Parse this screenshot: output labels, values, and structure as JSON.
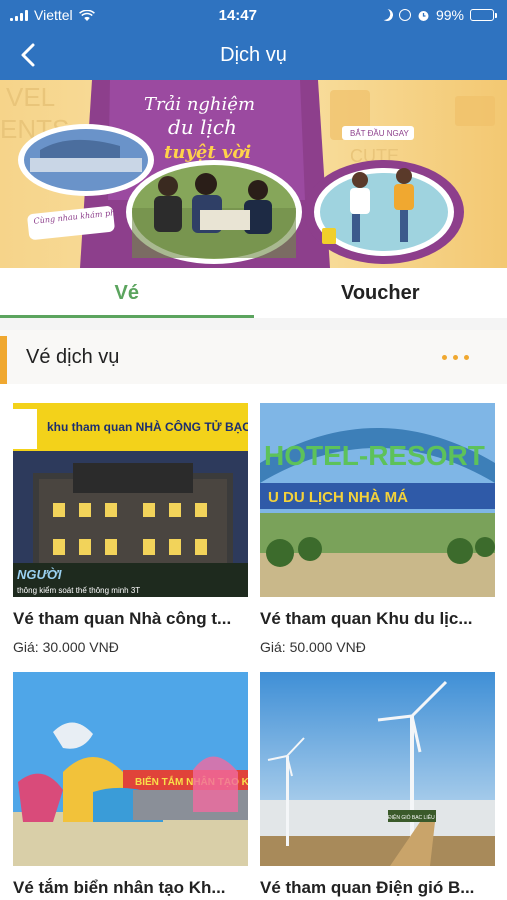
{
  "status_bar": {
    "carrier": "Viettel",
    "time": "14:47",
    "battery_percent": "99%",
    "battery_level": 0.99,
    "icons": [
      "signal-icon",
      "wifi-icon",
      "moon-icon",
      "orientation-lock-icon",
      "alarm-icon",
      "battery-charging-icon"
    ]
  },
  "header": {
    "title": "Dịch vụ",
    "back_icon": "chevron-left-icon"
  },
  "banner": {
    "headline_1": "Trải nghiệm",
    "headline_2": "du lịch",
    "headline_3": "tuyệt vời",
    "tag_left": "Cùng nhau khám phá!",
    "tag_right": "BẮT ĐẦU NGAY",
    "bg_text_left_1": "VEL",
    "bg_text_left_2": "ENTS",
    "bg_text_right": "CUTE"
  },
  "tabs": [
    {
      "label": "Vé",
      "active": true
    },
    {
      "label": "Voucher",
      "active": false
    }
  ],
  "section": {
    "title": "Vé dịch vụ",
    "more_icon": "more-dots-icon"
  },
  "cards": [
    {
      "title": "Vé tham quan Nhà công t...",
      "price": "Giá: 30.000 VNĐ",
      "image_sign": "khu tham quan NHÀ CÔNG TỬ BẠC L",
      "image_caption": "thông kiểm soát thế thông minh 3T",
      "image_watermark": "NGƯỜI"
    },
    {
      "title": "Vé tham quan Khu du lịc...",
      "price": "Giá: 50.000 VNĐ",
      "image_sign": "HOTEL-RESORT",
      "image_sign_2": "U DU LỊCH NHÀ MÁ"
    },
    {
      "title": "Vé tắm biển nhân tạo Kh...",
      "price": "",
      "image_sign": "BIỂN TẮM NHÂN TẠO KHU"
    },
    {
      "title": "Vé tham quan Điện gió B...",
      "price": "",
      "image_sign": "ĐIỆN GIÓ BẠC LIÊU"
    }
  ],
  "colors": {
    "primary_blue": "#2f73c0",
    "active_green": "#5ba45e",
    "accent_orange": "#f0a830"
  }
}
